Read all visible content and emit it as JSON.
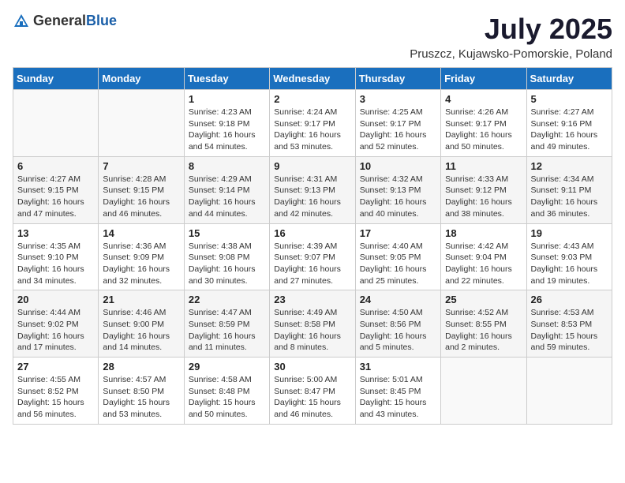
{
  "header": {
    "logo_general": "General",
    "logo_blue": "Blue",
    "month_title": "July 2025",
    "location": "Pruszcz, Kujawsko-Pomorskie, Poland"
  },
  "weekdays": [
    "Sunday",
    "Monday",
    "Tuesday",
    "Wednesday",
    "Thursday",
    "Friday",
    "Saturday"
  ],
  "weeks": [
    [
      {
        "day": "",
        "sunrise": "",
        "sunset": "",
        "daylight": ""
      },
      {
        "day": "",
        "sunrise": "",
        "sunset": "",
        "daylight": ""
      },
      {
        "day": "1",
        "sunrise": "Sunrise: 4:23 AM",
        "sunset": "Sunset: 9:18 PM",
        "daylight": "Daylight: 16 hours and 54 minutes."
      },
      {
        "day": "2",
        "sunrise": "Sunrise: 4:24 AM",
        "sunset": "Sunset: 9:17 PM",
        "daylight": "Daylight: 16 hours and 53 minutes."
      },
      {
        "day": "3",
        "sunrise": "Sunrise: 4:25 AM",
        "sunset": "Sunset: 9:17 PM",
        "daylight": "Daylight: 16 hours and 52 minutes."
      },
      {
        "day": "4",
        "sunrise": "Sunrise: 4:26 AM",
        "sunset": "Sunset: 9:17 PM",
        "daylight": "Daylight: 16 hours and 50 minutes."
      },
      {
        "day": "5",
        "sunrise": "Sunrise: 4:27 AM",
        "sunset": "Sunset: 9:16 PM",
        "daylight": "Daylight: 16 hours and 49 minutes."
      }
    ],
    [
      {
        "day": "6",
        "sunrise": "Sunrise: 4:27 AM",
        "sunset": "Sunset: 9:15 PM",
        "daylight": "Daylight: 16 hours and 47 minutes."
      },
      {
        "day": "7",
        "sunrise": "Sunrise: 4:28 AM",
        "sunset": "Sunset: 9:15 PM",
        "daylight": "Daylight: 16 hours and 46 minutes."
      },
      {
        "day": "8",
        "sunrise": "Sunrise: 4:29 AM",
        "sunset": "Sunset: 9:14 PM",
        "daylight": "Daylight: 16 hours and 44 minutes."
      },
      {
        "day": "9",
        "sunrise": "Sunrise: 4:31 AM",
        "sunset": "Sunset: 9:13 PM",
        "daylight": "Daylight: 16 hours and 42 minutes."
      },
      {
        "day": "10",
        "sunrise": "Sunrise: 4:32 AM",
        "sunset": "Sunset: 9:13 PM",
        "daylight": "Daylight: 16 hours and 40 minutes."
      },
      {
        "day": "11",
        "sunrise": "Sunrise: 4:33 AM",
        "sunset": "Sunset: 9:12 PM",
        "daylight": "Daylight: 16 hours and 38 minutes."
      },
      {
        "day": "12",
        "sunrise": "Sunrise: 4:34 AM",
        "sunset": "Sunset: 9:11 PM",
        "daylight": "Daylight: 16 hours and 36 minutes."
      }
    ],
    [
      {
        "day": "13",
        "sunrise": "Sunrise: 4:35 AM",
        "sunset": "Sunset: 9:10 PM",
        "daylight": "Daylight: 16 hours and 34 minutes."
      },
      {
        "day": "14",
        "sunrise": "Sunrise: 4:36 AM",
        "sunset": "Sunset: 9:09 PM",
        "daylight": "Daylight: 16 hours and 32 minutes."
      },
      {
        "day": "15",
        "sunrise": "Sunrise: 4:38 AM",
        "sunset": "Sunset: 9:08 PM",
        "daylight": "Daylight: 16 hours and 30 minutes."
      },
      {
        "day": "16",
        "sunrise": "Sunrise: 4:39 AM",
        "sunset": "Sunset: 9:07 PM",
        "daylight": "Daylight: 16 hours and 27 minutes."
      },
      {
        "day": "17",
        "sunrise": "Sunrise: 4:40 AM",
        "sunset": "Sunset: 9:05 PM",
        "daylight": "Daylight: 16 hours and 25 minutes."
      },
      {
        "day": "18",
        "sunrise": "Sunrise: 4:42 AM",
        "sunset": "Sunset: 9:04 PM",
        "daylight": "Daylight: 16 hours and 22 minutes."
      },
      {
        "day": "19",
        "sunrise": "Sunrise: 4:43 AM",
        "sunset": "Sunset: 9:03 PM",
        "daylight": "Daylight: 16 hours and 19 minutes."
      }
    ],
    [
      {
        "day": "20",
        "sunrise": "Sunrise: 4:44 AM",
        "sunset": "Sunset: 9:02 PM",
        "daylight": "Daylight: 16 hours and 17 minutes."
      },
      {
        "day": "21",
        "sunrise": "Sunrise: 4:46 AM",
        "sunset": "Sunset: 9:00 PM",
        "daylight": "Daylight: 16 hours and 14 minutes."
      },
      {
        "day": "22",
        "sunrise": "Sunrise: 4:47 AM",
        "sunset": "Sunset: 8:59 PM",
        "daylight": "Daylight: 16 hours and 11 minutes."
      },
      {
        "day": "23",
        "sunrise": "Sunrise: 4:49 AM",
        "sunset": "Sunset: 8:58 PM",
        "daylight": "Daylight: 16 hours and 8 minutes."
      },
      {
        "day": "24",
        "sunrise": "Sunrise: 4:50 AM",
        "sunset": "Sunset: 8:56 PM",
        "daylight": "Daylight: 16 hours and 5 minutes."
      },
      {
        "day": "25",
        "sunrise": "Sunrise: 4:52 AM",
        "sunset": "Sunset: 8:55 PM",
        "daylight": "Daylight: 16 hours and 2 minutes."
      },
      {
        "day": "26",
        "sunrise": "Sunrise: 4:53 AM",
        "sunset": "Sunset: 8:53 PM",
        "daylight": "Daylight: 15 hours and 59 minutes."
      }
    ],
    [
      {
        "day": "27",
        "sunrise": "Sunrise: 4:55 AM",
        "sunset": "Sunset: 8:52 PM",
        "daylight": "Daylight: 15 hours and 56 minutes."
      },
      {
        "day": "28",
        "sunrise": "Sunrise: 4:57 AM",
        "sunset": "Sunset: 8:50 PM",
        "daylight": "Daylight: 15 hours and 53 minutes."
      },
      {
        "day": "29",
        "sunrise": "Sunrise: 4:58 AM",
        "sunset": "Sunset: 8:48 PM",
        "daylight": "Daylight: 15 hours and 50 minutes."
      },
      {
        "day": "30",
        "sunrise": "Sunrise: 5:00 AM",
        "sunset": "Sunset: 8:47 PM",
        "daylight": "Daylight: 15 hours and 46 minutes."
      },
      {
        "day": "31",
        "sunrise": "Sunrise: 5:01 AM",
        "sunset": "Sunset: 8:45 PM",
        "daylight": "Daylight: 15 hours and 43 minutes."
      },
      {
        "day": "",
        "sunrise": "",
        "sunset": "",
        "daylight": ""
      },
      {
        "day": "",
        "sunrise": "",
        "sunset": "",
        "daylight": ""
      }
    ]
  ]
}
